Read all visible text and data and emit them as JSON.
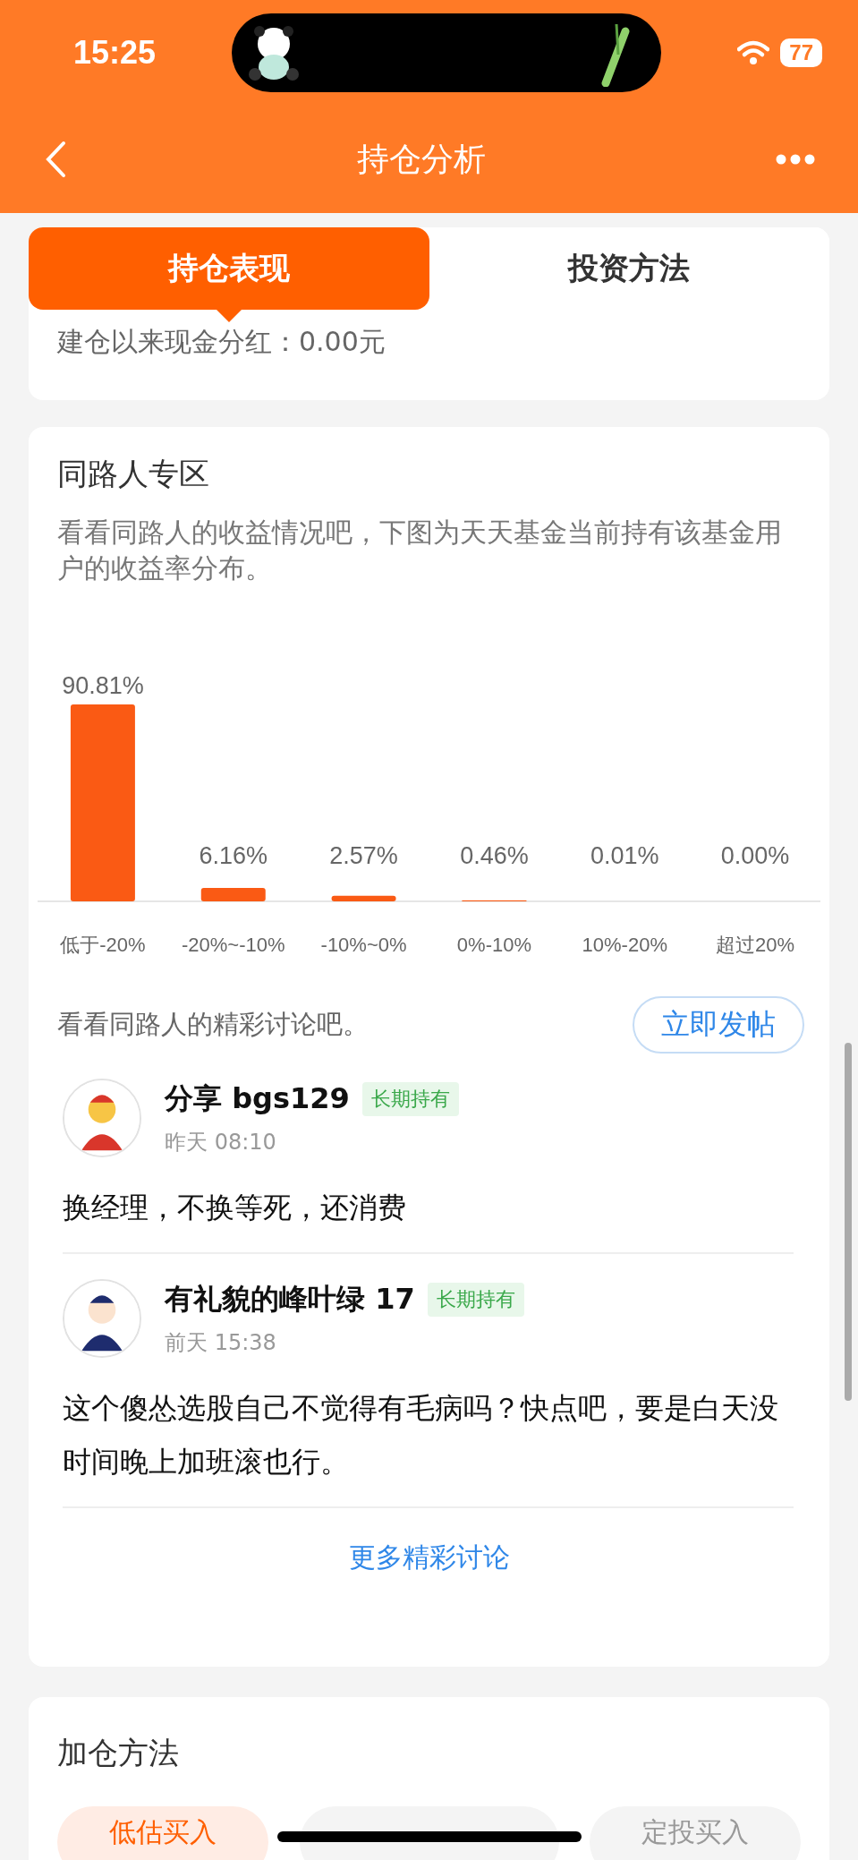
{
  "status_bar": {
    "time": "15:25",
    "battery": "77"
  },
  "nav": {
    "title": "持仓分析"
  },
  "tabs": [
    {
      "label": "持仓表现",
      "selected": true
    },
    {
      "label": "投资方法",
      "selected": false
    }
  ],
  "dividend": "建仓以来现金分红：0.00元",
  "peers": {
    "title": "同路人专区",
    "description": "看看同路人的收益情况吧，下图为天天基金当前持有该基金用户的收益率分布。",
    "chart_data": {
      "type": "bar",
      "categories": [
        "低于-20%",
        "-20%~-10%",
        "-10%~0%",
        "0%-10%",
        "10%-20%",
        "超过20%"
      ],
      "series": [
        {
          "color": "#fa5a14",
          "values": [
            90.81,
            6.16,
            2.57,
            0.46,
            0.01,
            0.0
          ],
          "value_labels": [
            "90.81%",
            "6.16%",
            "2.57%",
            "0.46%",
            "0.01%",
            "0.00%"
          ]
        }
      ],
      "data_labels": true
    },
    "discussion_prompt": "看看同路人的精彩讨论吧。",
    "post_button": "立即发帖",
    "comments": [
      {
        "user": "分享 bgs129",
        "tag": "长期持有",
        "time": "昨天 08:10",
        "text": "换经理，不换等死，还消费"
      },
      {
        "user": "有礼貌的峰叶绿 17",
        "tag": "长期持有",
        "time": "前天 15:38",
        "text": "这个傻怂选股自己不觉得有毛病吗？快点吧，要是白天没时间晚上加班滚也行。"
      }
    ],
    "more_link": "更多精彩讨论"
  },
  "add_methods": {
    "title": "加仓方法",
    "chips": [
      {
        "label": "低估买入",
        "selected": true
      },
      {
        "selected": false
      },
      {
        "label": "定投买入",
        "selected": false
      }
    ]
  }
}
